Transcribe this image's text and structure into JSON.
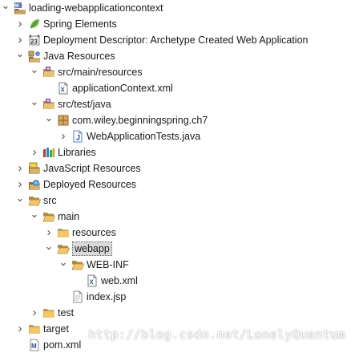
{
  "tree": [
    {
      "label": "loading-webapplicationcontext",
      "depth": 0,
      "toggle": "expanded",
      "icon": "maven-project-icon"
    },
    {
      "label": "Spring Elements",
      "depth": 1,
      "toggle": "collapsed",
      "icon": "spring-leaf-icon"
    },
    {
      "label": "Deployment Descriptor: Archetype Created Web Application",
      "depth": 1,
      "toggle": "collapsed",
      "icon": "deployment-descriptor-icon"
    },
    {
      "label": "Java Resources",
      "depth": 1,
      "toggle": "expanded",
      "icon": "java-resources-icon"
    },
    {
      "label": "src/main/resources",
      "depth": 2,
      "toggle": "expanded",
      "icon": "source-folder-icon"
    },
    {
      "label": "applicationContext.xml",
      "depth": 3,
      "toggle": "none",
      "icon": "xml-file-icon"
    },
    {
      "label": "src/test/java",
      "depth": 2,
      "toggle": "expanded",
      "icon": "source-folder-icon"
    },
    {
      "label": "com.wiley.beginningspring.ch7",
      "depth": 3,
      "toggle": "expanded",
      "icon": "package-icon"
    },
    {
      "label": "WebApplicationTests.java",
      "depth": 4,
      "toggle": "collapsed",
      "icon": "java-file-icon"
    },
    {
      "label": "Libraries",
      "depth": 2,
      "toggle": "collapsed",
      "icon": "libraries-icon"
    },
    {
      "label": "JavaScript Resources",
      "depth": 1,
      "toggle": "collapsed",
      "icon": "javascript-resources-icon"
    },
    {
      "label": "Deployed Resources",
      "depth": 1,
      "toggle": "collapsed",
      "icon": "deployed-resources-icon"
    },
    {
      "label": "src",
      "depth": 1,
      "toggle": "expanded",
      "icon": "folder-open-icon"
    },
    {
      "label": "main",
      "depth": 2,
      "toggle": "expanded",
      "icon": "folder-open-icon"
    },
    {
      "label": "resources",
      "depth": 3,
      "toggle": "collapsed",
      "icon": "folder-icon"
    },
    {
      "label": "webapp",
      "depth": 3,
      "toggle": "expanded",
      "icon": "folder-open-icon",
      "selected": true
    },
    {
      "label": "WEB-INF",
      "depth": 4,
      "toggle": "expanded",
      "icon": "folder-open-icon"
    },
    {
      "label": "web.xml",
      "depth": 5,
      "toggle": "none",
      "icon": "xml-file-icon"
    },
    {
      "label": "index.jsp",
      "depth": 4,
      "toggle": "none",
      "icon": "jsp-file-icon"
    },
    {
      "label": "test",
      "depth": 2,
      "toggle": "collapsed",
      "icon": "folder-icon"
    },
    {
      "label": "target",
      "depth": 1,
      "toggle": "collapsed",
      "icon": "folder-icon"
    },
    {
      "label": "pom.xml",
      "depth": 1,
      "toggle": "none",
      "icon": "maven-pom-icon"
    }
  ],
  "watermark": "http://blog.csdn.net/LonelyQuantum"
}
